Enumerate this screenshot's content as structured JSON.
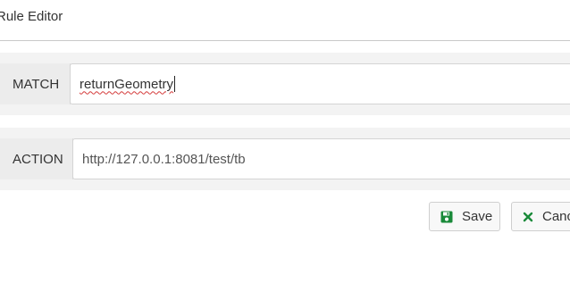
{
  "dialog": {
    "title": "Rule Editor"
  },
  "match": {
    "label": "MATCH",
    "value": "returnGeometry"
  },
  "action": {
    "label": "ACTION",
    "value": "http://127.0.0.1:8081/test/tb"
  },
  "buttons": {
    "save_label": "Save",
    "save_icon": "floppy-disk-icon",
    "save_icon_color": "#1a8a3a",
    "cancel_label": "Canc",
    "cancel_icon": "close-x-icon",
    "cancel_icon_color": "#1a8a3a"
  }
}
